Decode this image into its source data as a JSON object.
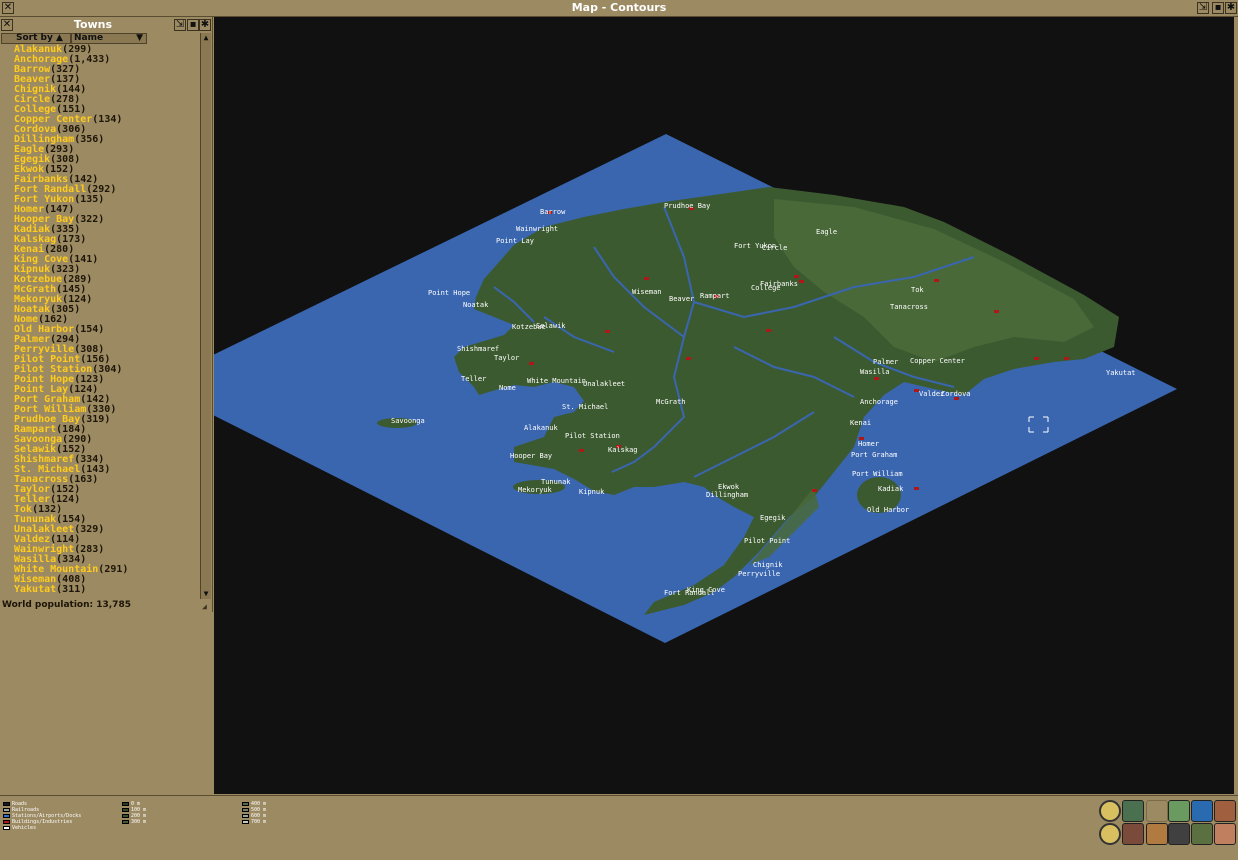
{
  "window": {
    "title": "Map - Contours"
  },
  "towns_panel": {
    "title": "Towns",
    "sort_label": "Sort by",
    "sort_field": "Name",
    "world_population": "World population: 13,785",
    "towns": [
      {
        "name": "Alakanuk",
        "pop": "(299)"
      },
      {
        "name": "Anchorage",
        "pop": "(1,433)"
      },
      {
        "name": "Barrow",
        "pop": "(327)"
      },
      {
        "name": "Beaver",
        "pop": "(137)"
      },
      {
        "name": "Chignik",
        "pop": "(144)"
      },
      {
        "name": "Circle",
        "pop": "(278)"
      },
      {
        "name": "College",
        "pop": "(151)"
      },
      {
        "name": "Copper Center",
        "pop": "(134)"
      },
      {
        "name": "Cordova",
        "pop": "(306)"
      },
      {
        "name": "Dillingham",
        "pop": "(356)"
      },
      {
        "name": "Eagle",
        "pop": "(293)"
      },
      {
        "name": "Egegik",
        "pop": "(308)"
      },
      {
        "name": "Ekwok",
        "pop": "(152)"
      },
      {
        "name": "Fairbanks",
        "pop": "(142)"
      },
      {
        "name": "Fort Randall",
        "pop": "(292)"
      },
      {
        "name": "Fort Yukon",
        "pop": "(135)"
      },
      {
        "name": "Homer",
        "pop": "(147)"
      },
      {
        "name": "Hooper Bay",
        "pop": "(322)"
      },
      {
        "name": "Kadiak",
        "pop": "(335)"
      },
      {
        "name": "Kalskag",
        "pop": "(173)"
      },
      {
        "name": "Kenai",
        "pop": "(280)"
      },
      {
        "name": "King Cove",
        "pop": "(141)"
      },
      {
        "name": "Kipnuk",
        "pop": "(323)"
      },
      {
        "name": "Kotzebue",
        "pop": "(289)"
      },
      {
        "name": "McGrath",
        "pop": "(145)"
      },
      {
        "name": "Mekoryuk",
        "pop": "(124)"
      },
      {
        "name": "Noatak",
        "pop": "(305)"
      },
      {
        "name": "Nome",
        "pop": "(162)"
      },
      {
        "name": "Old Harbor",
        "pop": "(154)"
      },
      {
        "name": "Palmer",
        "pop": "(294)"
      },
      {
        "name": "Perryville",
        "pop": "(308)"
      },
      {
        "name": "Pilot Point",
        "pop": "(156)"
      },
      {
        "name": "Pilot Station",
        "pop": "(304)"
      },
      {
        "name": "Point Hope",
        "pop": "(123)"
      },
      {
        "name": "Point Lay",
        "pop": "(124)"
      },
      {
        "name": "Port Graham",
        "pop": "(142)"
      },
      {
        "name": "Port William",
        "pop": "(330)"
      },
      {
        "name": "Prudhoe Bay",
        "pop": "(319)"
      },
      {
        "name": "Rampart",
        "pop": "(184)"
      },
      {
        "name": "Savoonga",
        "pop": "(290)"
      },
      {
        "name": "Selawik",
        "pop": "(152)"
      },
      {
        "name": "Shishmaref",
        "pop": "(334)"
      },
      {
        "name": "St. Michael",
        "pop": "(143)"
      },
      {
        "name": "Tanacross",
        "pop": "(163)"
      },
      {
        "name": "Taylor",
        "pop": "(152)"
      },
      {
        "name": "Teller",
        "pop": "(124)"
      },
      {
        "name": "Tok",
        "pop": "(132)"
      },
      {
        "name": "Tununak",
        "pop": "(154)"
      },
      {
        "name": "Unalakleet",
        "pop": "(329)"
      },
      {
        "name": "Valdez",
        "pop": "(114)"
      },
      {
        "name": "Wainwright",
        "pop": "(283)"
      },
      {
        "name": "Wasilla",
        "pop": "(334)"
      },
      {
        "name": "White Mountain",
        "pop": "(291)"
      },
      {
        "name": "Wiseman",
        "pop": "(408)"
      },
      {
        "name": "Yakutat",
        "pop": "(311)"
      }
    ]
  },
  "map_labels": [
    "Barrow",
    "Prudhoe Bay",
    "Wainwright",
    "Point Lay",
    "Fort Yukon",
    "Circle",
    "Eagle",
    "Fairbanks",
    "College",
    "Wiseman",
    "Beaver",
    "Rampart",
    "Point Hope",
    "Noatak",
    "Kotzebue",
    "Selawik",
    "Tok",
    "Tanacross",
    "Shishmaref",
    "Taylor",
    "Teller",
    "White Mountain",
    "Nome",
    "Unalakleet",
    "Palmer",
    "Copper Center",
    "Wasilla",
    "Valdez",
    "Cordova",
    "Anchorage",
    "Yakutat",
    "Savoonga",
    "St. Michael",
    "McGrath",
    "Kenai",
    "Alakanuk",
    "Pilot Station",
    "Homer",
    "Kalskag",
    "Port Graham",
    "Hooper Bay",
    "Port William",
    "Tununak",
    "Ekwok",
    "Kadiak",
    "Mekoryuk",
    "Kipnuk",
    "Dillingham",
    "Old Harbor",
    "Egegik",
    "Pilot Point",
    "Chignik",
    "Perryville",
    "King Cove",
    "Fort Randall"
  ],
  "legend": {
    "features": [
      {
        "label": "Roads",
        "color": "#1a1a1a"
      },
      {
        "label": "Railroads",
        "color": "#a0a0a0"
      },
      {
        "label": "Stations/Airports/Docks",
        "color": "#3070d0"
      },
      {
        "label": "Buildings/Industries",
        "color": "#b01818"
      },
      {
        "label": "Vehicles",
        "color": "#ffffff"
      }
    ],
    "elevations_a": [
      {
        "label": "0 m",
        "color": "#2a3a22"
      },
      {
        "label": "100 m",
        "color": "#34482a"
      },
      {
        "label": "200 m",
        "color": "#3c5030"
      },
      {
        "label": "300 m",
        "color": "#465a3a"
      }
    ],
    "elevations_b": [
      {
        "label": "400 m",
        "color": "#58684c"
      },
      {
        "label": "500 m",
        "color": "#72806a"
      },
      {
        "label": "600 m",
        "color": "#98a290"
      },
      {
        "label": "700 m",
        "color": "#c4c8c0"
      }
    ]
  },
  "colors": {
    "water": "#3a66b0",
    "land": "#3c5a30",
    "highland": "#4a6a3a",
    "background": "#111111",
    "panel": "#9c8a62"
  }
}
